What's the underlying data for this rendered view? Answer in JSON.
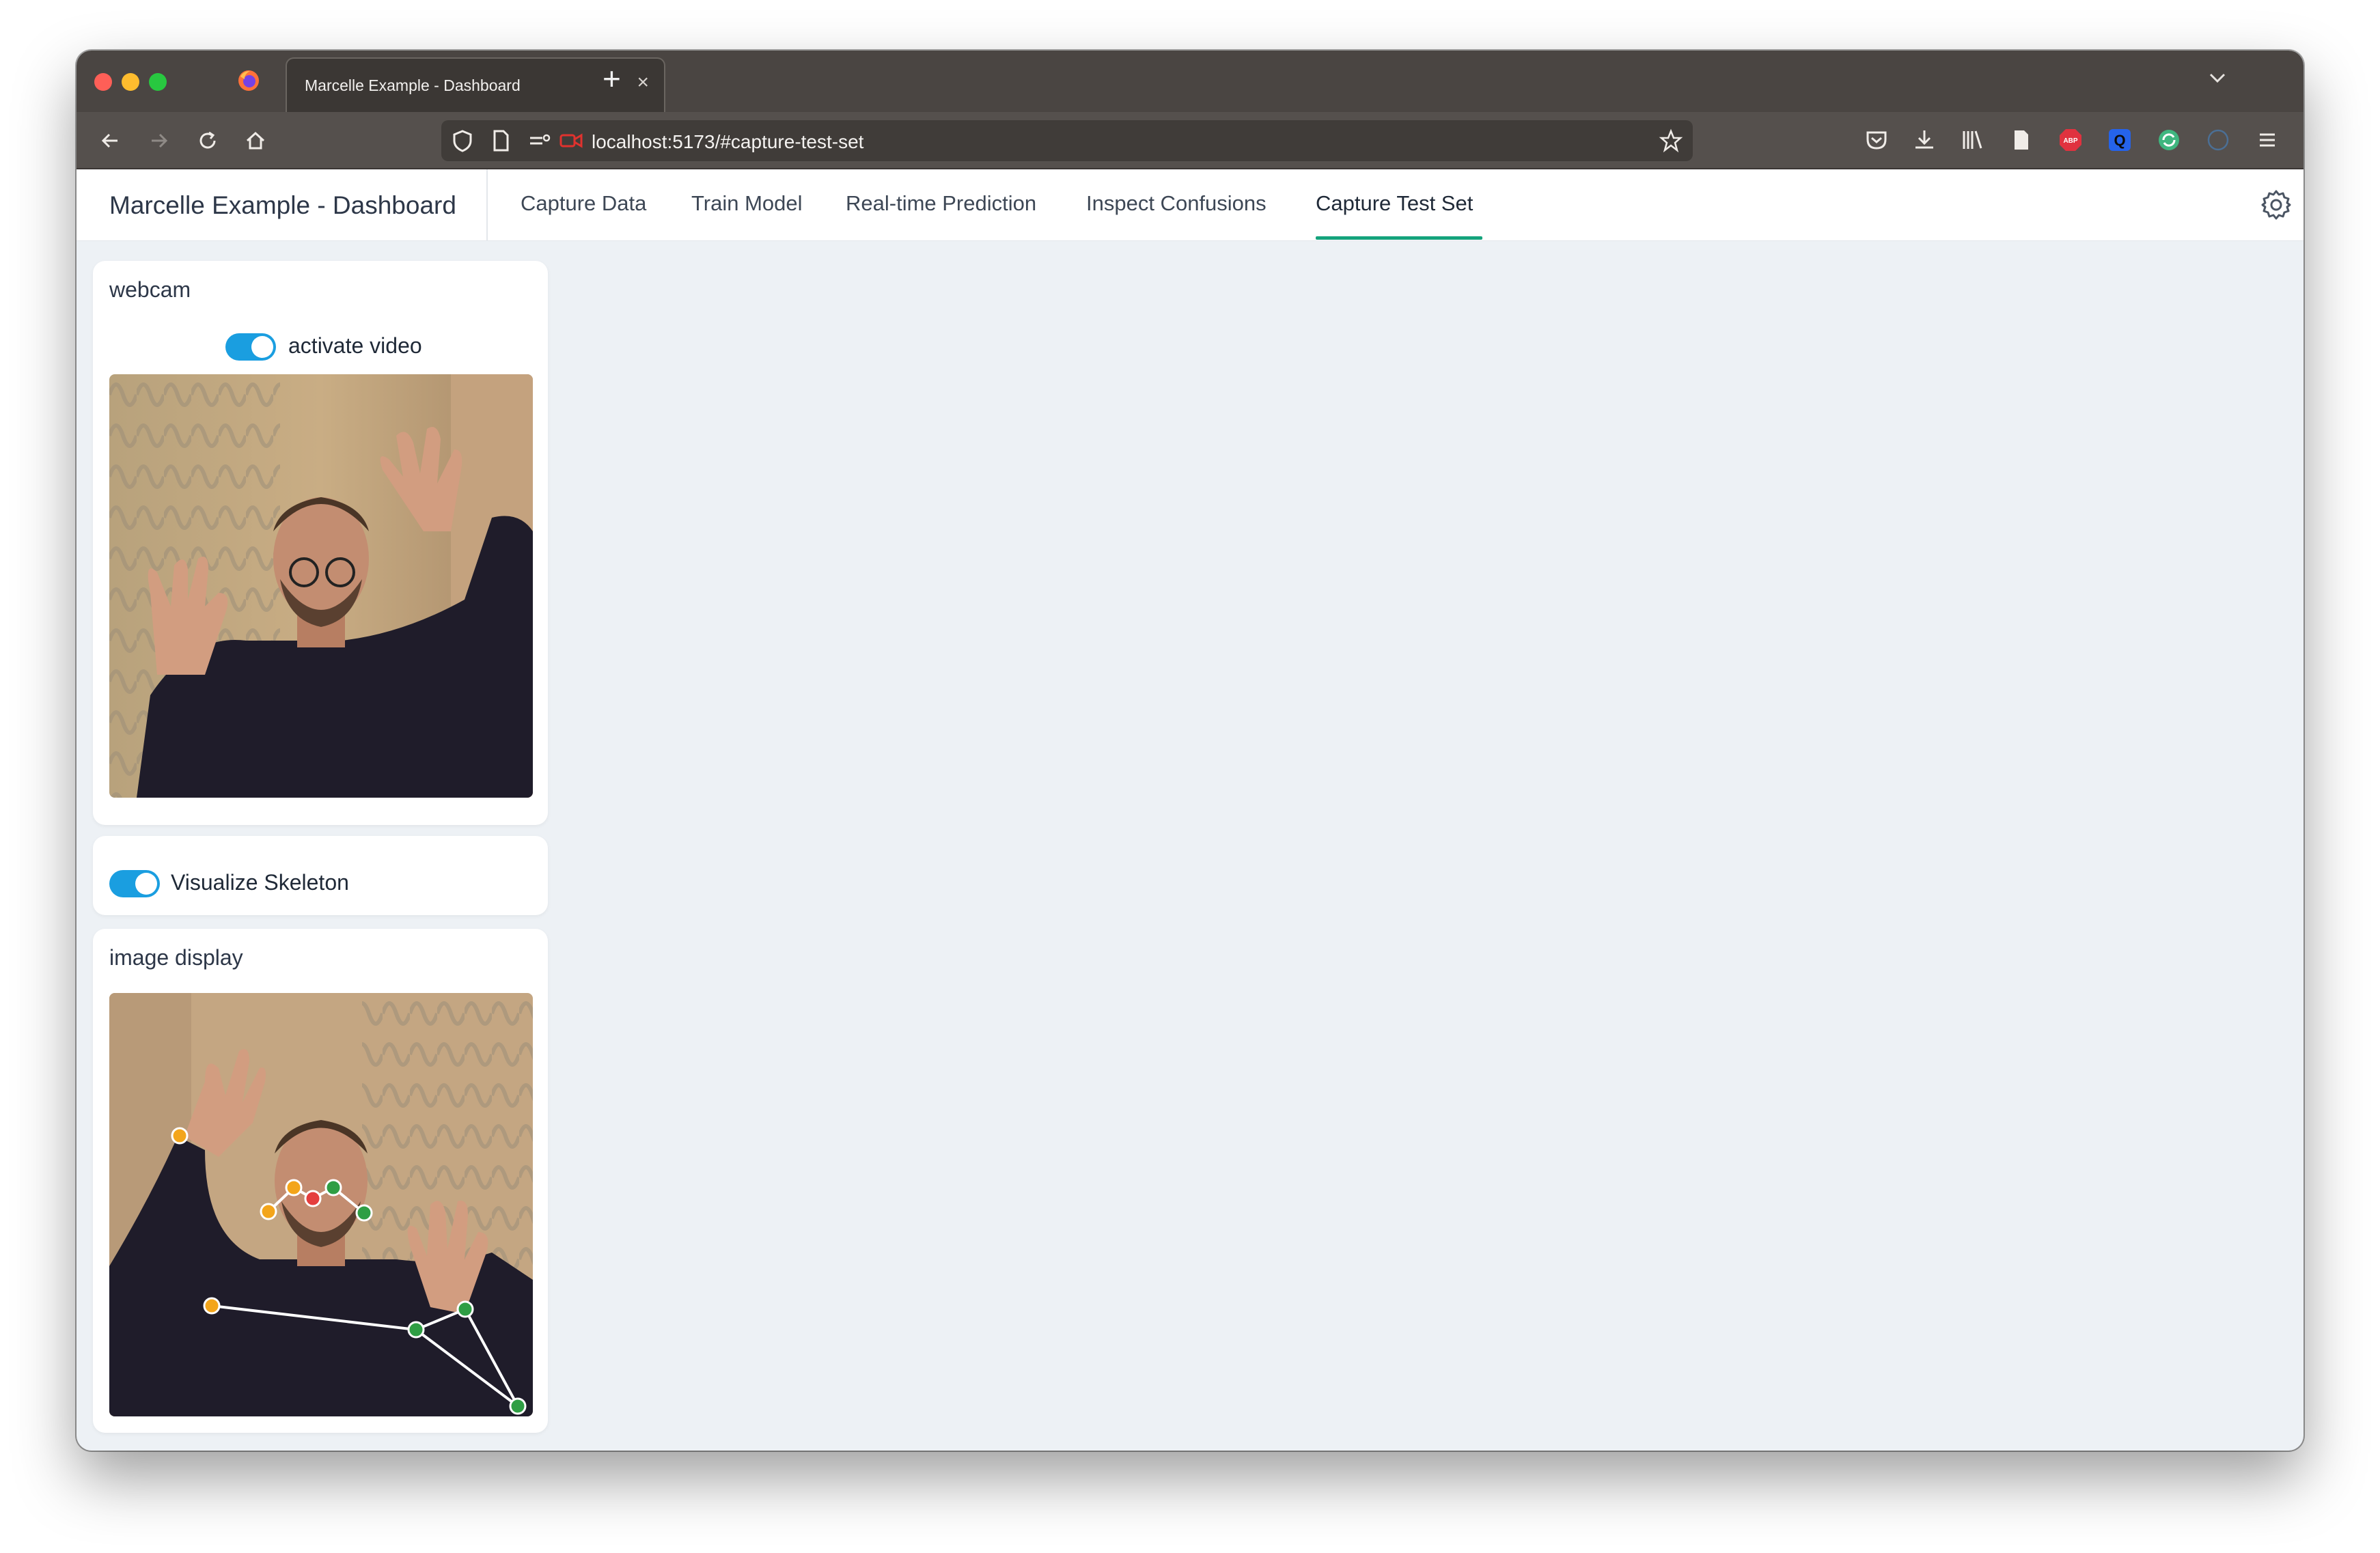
{
  "browser": {
    "tab_title": "Marcelle Example - Dashboard",
    "tab_close": "×",
    "new_tab": "+",
    "url": "localhost:5173/#capture-test-set"
  },
  "app": {
    "title": "Marcelle Example - Dashboard",
    "nav_tabs": [
      {
        "label": "Capture Data",
        "active": false
      },
      {
        "label": "Train Model",
        "active": false
      },
      {
        "label": "Real-time Prediction",
        "active": false
      },
      {
        "label": "Inspect Confusions",
        "active": false
      },
      {
        "label": "Capture Test Set",
        "active": true
      }
    ],
    "accent_color": "#15a37c",
    "toggle_color": "#1a9ee0"
  },
  "webcam": {
    "title": "webcam",
    "toggle_label": "activate video",
    "toggle_on": true
  },
  "skeleton": {
    "toggle_label": "Visualize Skeleton",
    "toggle_on": true
  },
  "image_display": {
    "title": "image display"
  },
  "extensions": [
    "pocket-icon",
    "download-icon",
    "library-icon",
    "reader-icon",
    "adblock-icon",
    "q-extension-icon",
    "sync-extension-icon",
    "profile-icon",
    "menu-icon"
  ]
}
